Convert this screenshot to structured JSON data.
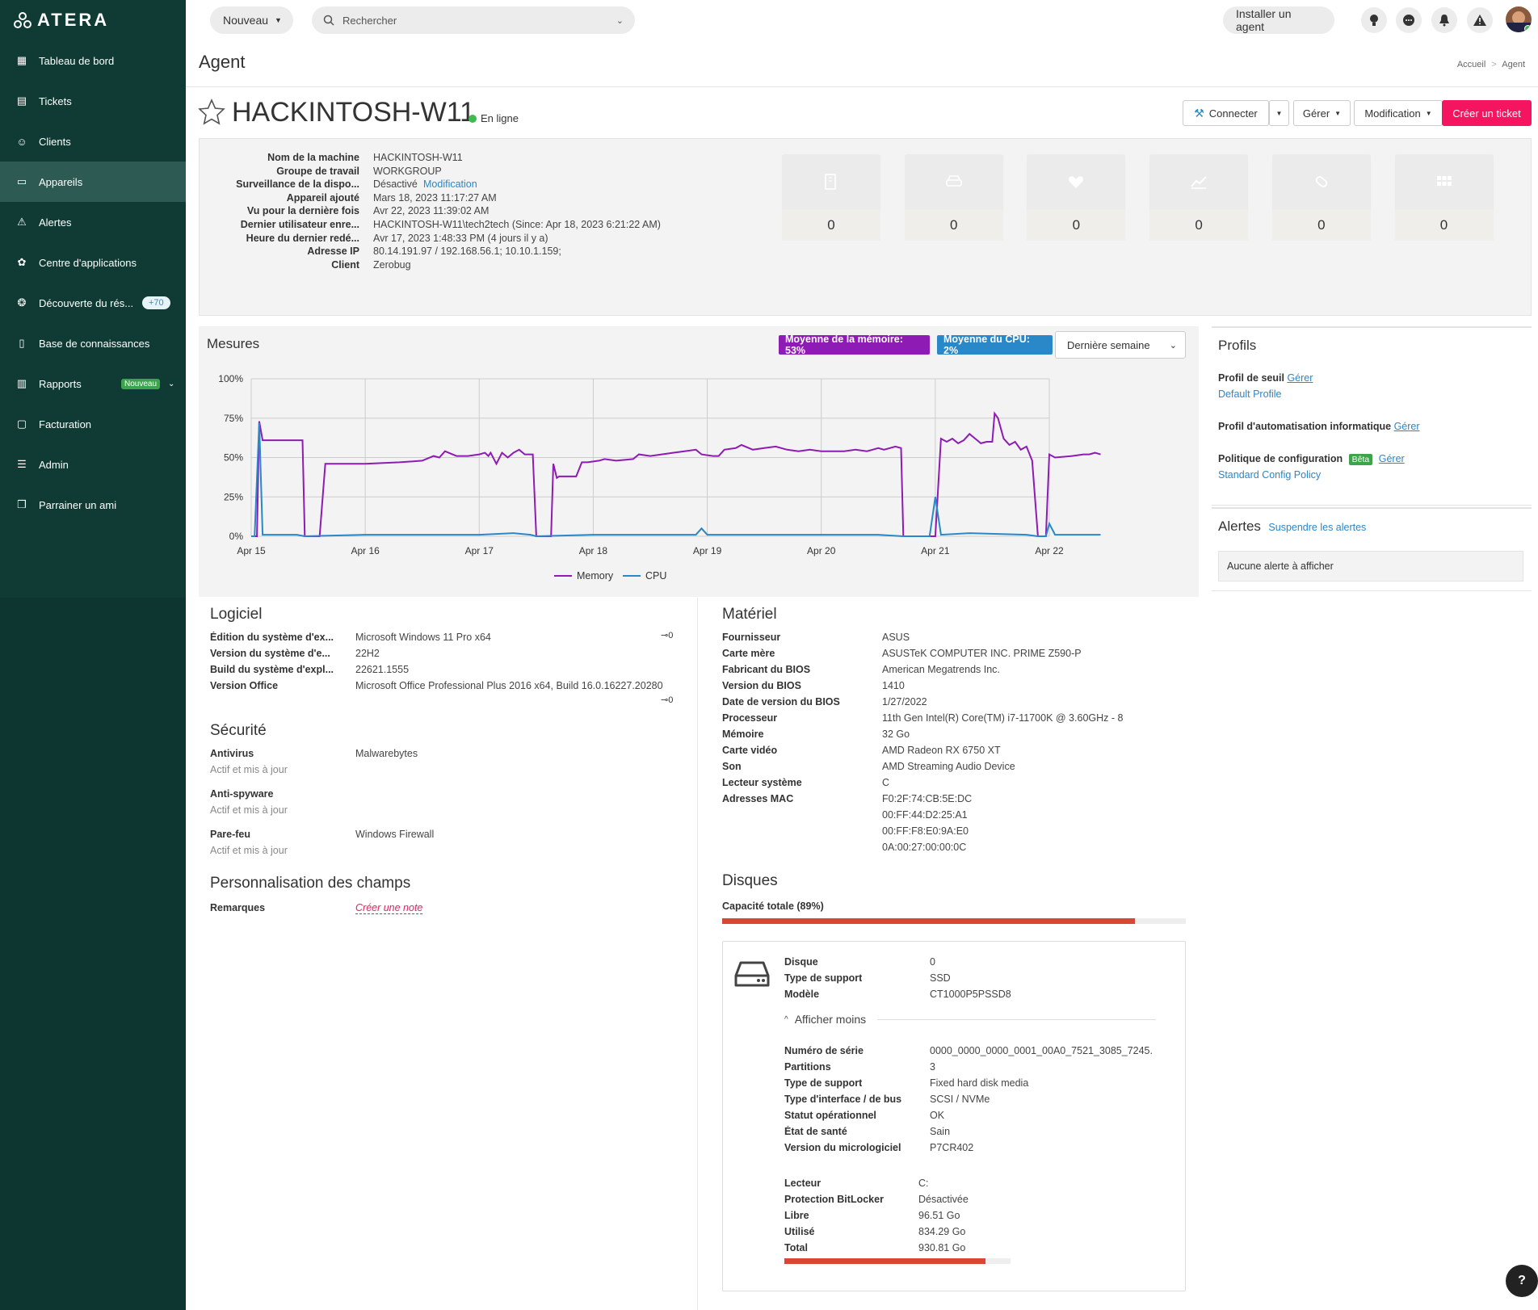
{
  "app": {
    "logo": "ATERA"
  },
  "sidebar": {
    "items": [
      {
        "label": "Tableau de bord",
        "icon": "dashboard-icon"
      },
      {
        "label": "Tickets",
        "icon": "ticket-icon"
      },
      {
        "label": "Clients",
        "icon": "users-icon"
      },
      {
        "label": "Appareils",
        "icon": "monitor-icon",
        "active": true
      },
      {
        "label": "Alertes",
        "icon": "warning-icon"
      },
      {
        "label": "Centre d'applications",
        "icon": "apps-icon"
      },
      {
        "label": "Découverte du rés...",
        "icon": "network-icon",
        "pill": "+70"
      },
      {
        "label": "Base de connaissances",
        "icon": "book-icon"
      },
      {
        "label": "Rapports",
        "icon": "chart-icon",
        "pill": "Nouveau"
      },
      {
        "label": "Facturation",
        "icon": "billing-icon"
      },
      {
        "label": "Admin",
        "icon": "sliders-icon"
      },
      {
        "label": "Parrainer un ami",
        "icon": "gift-icon"
      }
    ]
  },
  "topbar": {
    "new_label": "Nouveau",
    "search_placeholder": "Rechercher",
    "install_agent": "Installer un agent"
  },
  "page": {
    "title": "Agent",
    "breadcrumb_home": "Accueil",
    "breadcrumb_sep": ">",
    "breadcrumb_current": "Agent"
  },
  "device": {
    "name": "HACKINTOSH-W11",
    "status": "En ligne"
  },
  "actions": {
    "connect": "Connecter",
    "manage": "Gérer",
    "modify": "Modification",
    "create_ticket": "Créer un ticket"
  },
  "info": [
    {
      "k": "Nom de la machine",
      "v": "HACKINTOSH-W11"
    },
    {
      "k": "Groupe de travail",
      "v": "WORKGROUP"
    },
    {
      "k": "Surveillance de la dispo...",
      "v": "Désactivé",
      "link": "Modification"
    },
    {
      "k": "Appareil ajouté",
      "v": "Mars 18, 2023 11:17:27 AM"
    },
    {
      "k": "Vu pour la dernière fois",
      "v": "Avr 22, 2023 11:39:02 AM"
    },
    {
      "k": "Dernier utilisateur enre...",
      "v": "HACKINTOSH-W11\\tech2tech (Since: Apr 18, 2023 6:21:22 AM)"
    },
    {
      "k": "Heure du dernier redé...",
      "v": "Avr 17, 2023 1:48:33 PM (4 jours il y a)"
    },
    {
      "k": "Adresse IP",
      "v": "80.14.191.97 / 192.168.56.1; 10.10.1.159;"
    },
    {
      "k": "Client",
      "v": "Zerobug",
      "is_link": true
    }
  ],
  "stats": [
    {
      "icon": "building-icon",
      "value": "0"
    },
    {
      "icon": "drive-icon",
      "value": "0"
    },
    {
      "icon": "heartbeat-icon",
      "value": "0"
    },
    {
      "icon": "trend-icon",
      "value": "0"
    },
    {
      "icon": "patch-icon",
      "value": "0"
    },
    {
      "icon": "grid-icon",
      "value": "0"
    }
  ],
  "metrics": {
    "title": "Mesures",
    "mem_badge": "Moyenne de la mémoire: 53%",
    "cpu_badge": "Moyenne du CPU: 2%",
    "period": "Dernière semaine",
    "colors": {
      "memory": "#8e1bb3",
      "cpu": "#2a87c8"
    }
  },
  "chart_data": {
    "type": "line",
    "x": [
      "Apr 15",
      "Apr 16",
      "Apr 17",
      "Apr 18",
      "Apr 19",
      "Apr 20",
      "Apr 21",
      "Apr 22"
    ],
    "yticks": [
      "0%",
      "25%",
      "50%",
      "75%",
      "100%"
    ],
    "ylim": [
      0,
      100
    ],
    "series": [
      {
        "name": "Memory",
        "points": [
          [
            0,
            0
          ],
          [
            0.05,
            0
          ],
          [
            0.07,
            73
          ],
          [
            0.1,
            61
          ],
          [
            0.3,
            61
          ],
          [
            0.42,
            61
          ],
          [
            0.45,
            61
          ],
          [
            0.47,
            0
          ],
          [
            0.6,
            0
          ],
          [
            0.65,
            46
          ],
          [
            1.0,
            46
          ],
          [
            1.3,
            47
          ],
          [
            1.5,
            48
          ],
          [
            1.6,
            51
          ],
          [
            1.65,
            50
          ],
          [
            1.7,
            54
          ],
          [
            1.8,
            51
          ],
          [
            1.9,
            51
          ],
          [
            2.0,
            52
          ],
          [
            2.05,
            53
          ],
          [
            2.08,
            51
          ],
          [
            2.1,
            53
          ],
          [
            2.15,
            46
          ],
          [
            2.2,
            53
          ],
          [
            2.25,
            50
          ],
          [
            2.3,
            53
          ],
          [
            2.35,
            55
          ],
          [
            2.4,
            52
          ],
          [
            2.47,
            52
          ],
          [
            2.5,
            0
          ],
          [
            2.63,
            0
          ],
          [
            2.65,
            46
          ],
          [
            2.68,
            37
          ],
          [
            2.7,
            38
          ],
          [
            2.85,
            38
          ],
          [
            2.9,
            47
          ],
          [
            2.95,
            47
          ],
          [
            3.05,
            48
          ],
          [
            3.1,
            49
          ],
          [
            3.2,
            48
          ],
          [
            3.35,
            49
          ],
          [
            3.4,
            52
          ],
          [
            3.5,
            51
          ],
          [
            3.6,
            52
          ],
          [
            3.7,
            53
          ],
          [
            3.8,
            54
          ],
          [
            3.9,
            55
          ],
          [
            3.95,
            52
          ],
          [
            4.05,
            51
          ],
          [
            4.1,
            51
          ],
          [
            4.15,
            55
          ],
          [
            4.25,
            56
          ],
          [
            4.3,
            58
          ],
          [
            4.4,
            55
          ],
          [
            4.5,
            56
          ],
          [
            4.6,
            57
          ],
          [
            4.7,
            55
          ],
          [
            4.8,
            54
          ],
          [
            4.9,
            55
          ],
          [
            5.0,
            54
          ],
          [
            5.1,
            54
          ],
          [
            5.2,
            54
          ],
          [
            5.3,
            55
          ],
          [
            5.4,
            54
          ],
          [
            5.45,
            55
          ],
          [
            5.5,
            56
          ],
          [
            5.55,
            55
          ],
          [
            5.65,
            57
          ],
          [
            5.7,
            56
          ],
          [
            5.72,
            0
          ],
          [
            5.8,
            0
          ],
          [
            6.0,
            0
          ],
          [
            6.05,
            62
          ],
          [
            6.1,
            60
          ],
          [
            6.15,
            62
          ],
          [
            6.2,
            59
          ],
          [
            6.25,
            61
          ],
          [
            6.3,
            65
          ],
          [
            6.35,
            62
          ],
          [
            6.4,
            59
          ],
          [
            6.45,
            60
          ],
          [
            6.5,
            60
          ],
          [
            6.52,
            78
          ],
          [
            6.55,
            75
          ],
          [
            6.6,
            62
          ],
          [
            6.65,
            58
          ],
          [
            6.7,
            60
          ],
          [
            6.75,
            55
          ],
          [
            6.8,
            57
          ],
          [
            6.85,
            48
          ],
          [
            6.9,
            0
          ],
          [
            6.97,
            0
          ],
          [
            7.0,
            52
          ],
          [
            7.05,
            50
          ],
          [
            7.2,
            51
          ],
          [
            7.3,
            52
          ],
          [
            7.35,
            52
          ],
          [
            7.4,
            53
          ],
          [
            7.45,
            52
          ]
        ]
      },
      {
        "name": "CPU",
        "points": [
          [
            0,
            0
          ],
          [
            0.03,
            0
          ],
          [
            0.07,
            72
          ],
          [
            0.1,
            1
          ],
          [
            0.4,
            1
          ],
          [
            0.47,
            0
          ],
          [
            1.0,
            1
          ],
          [
            1.5,
            1
          ],
          [
            2.0,
            1
          ],
          [
            2.3,
            2
          ],
          [
            2.45,
            1
          ],
          [
            2.5,
            0
          ],
          [
            3.0,
            1
          ],
          [
            3.5,
            1
          ],
          [
            3.9,
            1
          ],
          [
            3.95,
            5
          ],
          [
            4.0,
            1
          ],
          [
            4.5,
            1
          ],
          [
            5.0,
            1
          ],
          [
            5.5,
            1
          ],
          [
            5.72,
            0
          ],
          [
            5.95,
            0
          ],
          [
            6.0,
            25
          ],
          [
            6.05,
            1
          ],
          [
            6.3,
            2
          ],
          [
            6.8,
            1
          ],
          [
            6.9,
            0
          ],
          [
            6.97,
            0
          ],
          [
            7.0,
            8
          ],
          [
            7.05,
            1
          ],
          [
            7.45,
            1
          ]
        ]
      }
    ]
  },
  "profiles": {
    "title": "Profils",
    "threshold_label": "Profil de seuil",
    "threshold_link": "Gérer",
    "threshold_value": "Default Profile",
    "auto_label": "Profil d'automatisation informatique",
    "auto_link": "Gérer",
    "config_label": "Politique de configuration",
    "config_badge": "Bêta",
    "config_link": "Gérer",
    "config_value": "Standard Config Policy"
  },
  "alerts": {
    "title": "Alertes",
    "suspend": "Suspendre les alertes",
    "empty": "Aucune alerte à afficher"
  },
  "software": {
    "title": "Logiciel",
    "rows": [
      {
        "k": "Édition du système d'ex...",
        "v": "Microsoft Windows 11 Pro x64"
      },
      {
        "k": "Version du système d'e...",
        "v": "22H2"
      },
      {
        "k": "Build du système d'expl...",
        "v": "22621.1555"
      },
      {
        "k": "Version Office",
        "v": "Microsoft Office Professional Plus 2016 x64, Build 16.0.16227.20280"
      }
    ]
  },
  "security": {
    "title": "Sécurité",
    "rows": [
      {
        "k": "Antivirus",
        "v": "Malwarebytes",
        "sub": "Actif et mis à jour"
      },
      {
        "k": "Anti-spyware",
        "v": "",
        "sub": "Actif et mis à jour"
      },
      {
        "k": "Pare-feu",
        "v": "Windows Firewall",
        "sub": "Actif et mis à jour"
      }
    ]
  },
  "custom": {
    "title": "Personnalisation des champs",
    "remarks_label": "Remarques",
    "remarks_link": "Créer une note"
  },
  "hardware": {
    "title": "Matériel",
    "rows": [
      {
        "k": "Fournisseur",
        "v": "ASUS"
      },
      {
        "k": "Carte mère",
        "v": "ASUSTeK COMPUTER INC. PRIME Z590-P"
      },
      {
        "k": "Fabricant du BIOS",
        "v": "American Megatrends Inc."
      },
      {
        "k": "Version du BIOS",
        "v": "1410"
      },
      {
        "k": "Date de version du BIOS",
        "v": "1/27/2022"
      },
      {
        "k": "Processeur",
        "v": "11th Gen Intel(R) Core(TM) i7-11700K @ 3.60GHz - 8"
      },
      {
        "k": "Mémoire",
        "v": "32 Go"
      },
      {
        "k": "Carte vidéo",
        "v": "AMD Radeon RX 6750 XT"
      },
      {
        "k": "Son",
        "v": "AMD Streaming Audio Device"
      },
      {
        "k": "Lecteur système",
        "v": "C"
      },
      {
        "k": "Adresses MAC",
        "v": "F0:2F:74:CB:5E:DC"
      }
    ],
    "mac_extra": [
      "00:FF:44:D2:25:A1",
      "00:FF:F8:E0:9A:E0",
      "0A:00:27:00:00:0C"
    ]
  },
  "disks": {
    "title": "Disques",
    "capacity_label": "Capacité totale (89%)",
    "capacity_pct": 89,
    "card": [
      {
        "k": "Disque",
        "v": "0"
      },
      {
        "k": "Type de support",
        "v": "SSD"
      },
      {
        "k": "Modèle",
        "v": "CT1000P5PSSD8"
      }
    ],
    "show_less": "Afficher moins",
    "details": [
      {
        "k": "Numéro de série",
        "v": "0000_0000_0000_0001_00A0_7521_3085_7245."
      },
      {
        "k": "Partitions",
        "v": "3"
      },
      {
        "k": "Type de support",
        "v": "Fixed hard disk media"
      },
      {
        "k": "Type d'interface / de bus",
        "v": "SCSI / NVMe"
      },
      {
        "k": "Statut opérationnel",
        "v": "OK"
      },
      {
        "k": "État de santé",
        "v": "Sain"
      },
      {
        "k": "Version du micrologiciel",
        "v": "P7CR402"
      }
    ],
    "volume": [
      {
        "k": "Lecteur",
        "v": "C:"
      },
      {
        "k": "Protection BitLocker",
        "v": "Désactivée"
      },
      {
        "k": "Libre",
        "v": "96.51 Go"
      },
      {
        "k": "Utilisé",
        "v": "834.29 Go"
      },
      {
        "k": "Total",
        "v": "930.81 Go"
      }
    ],
    "volume_pct": 89
  },
  "help": "?"
}
